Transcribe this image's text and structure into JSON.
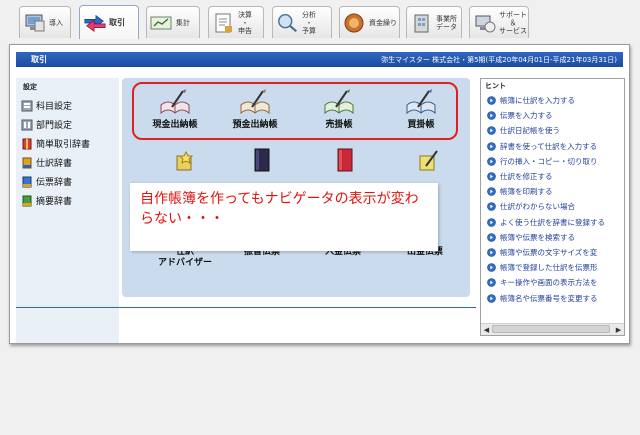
{
  "tabs": [
    {
      "id": "intro",
      "label": "導入",
      "icon": "intro-computer-icon"
    },
    {
      "id": "torihiki",
      "label": "取引",
      "icon": "transaction-arrows-icon",
      "active": true
    },
    {
      "id": "shukei",
      "label": "集計",
      "icon": "ledger-chart-icon"
    },
    {
      "id": "kessan",
      "label": "決算\n・\n申告",
      "icon": "settlement-document-icon"
    },
    {
      "id": "bunseki",
      "label": "分析\n・\n予算",
      "icon": "analysis-magnifier-icon"
    },
    {
      "id": "shikin",
      "label": "資金繰り",
      "icon": "funds-icon"
    },
    {
      "id": "jigyosho",
      "label": "事業所\nデータ",
      "icon": "office-data-icon"
    },
    {
      "id": "support",
      "label": "サポート\n＆\nサービス",
      "icon": "support-icon"
    }
  ],
  "window": {
    "title": "取引",
    "company_info": "弥生マイスター 株式会社・第5期(平成20年04月01日-平成21年03月31日)"
  },
  "side_panel": {
    "heading": "設定",
    "items": [
      {
        "label": "科目設定",
        "icon": "account-settings-icon"
      },
      {
        "label": "部門設定",
        "icon": "department-settings-icon"
      },
      {
        "label": "簡単取引辞書",
        "icon": "easy-dictionary-icon"
      },
      {
        "label": "仕訳辞書",
        "icon": "journal-dictionary-icon"
      },
      {
        "label": "伝票辞書",
        "icon": "slip-dictionary-icon"
      },
      {
        "label": "摘要辞書",
        "icon": "summary-dictionary-icon"
      }
    ]
  },
  "navigator": {
    "books": [
      {
        "label": "現金出納帳",
        "icon": "cash-book-icon"
      },
      {
        "label": "預金出納帳",
        "icon": "deposit-book-icon"
      },
      {
        "label": "売掛帳",
        "icon": "receivable-book-icon"
      },
      {
        "label": "買掛帳",
        "icon": "payable-book-icon"
      }
    ],
    "slips": [
      {
        "label": "仕訳\nアドバイザー",
        "icon": "journal-advisor-icon"
      },
      {
        "label": "振替伝票",
        "icon": "transfer-slip-icon"
      },
      {
        "label": "入金伝票",
        "icon": "receipt-slip-icon"
      },
      {
        "label": "出金伝票",
        "icon": "payment-slip-icon"
      }
    ],
    "callout_text": "自作帳簿を作ってもナビゲータの表示が変わらない・・・"
  },
  "hint_panel": {
    "heading": "ヒント",
    "items": [
      "帳簿に仕訳を入力する",
      "伝票を入力する",
      "仕訳日記帳を使う",
      "辞書を使って仕訳を入力する",
      "行の挿入・コピー・切り取り",
      "仕訳を修正する",
      "帳簿を印刷する",
      "仕訳がわからない場合",
      "よく使う仕訳を辞書に登録する",
      "帳簿や伝票を検索する",
      "帳簿や伝票の文字サイズを変",
      "帳簿で登録した仕訳を伝票形",
      "キー操作や画面の表示方法を",
      "帳簿名や伝票番号を変更する"
    ]
  },
  "colors": {
    "title_bar": "#1c4b9f",
    "navigator_bg": "#c9dbed",
    "highlight_border": "#e02020",
    "callout_text": "#e0140e",
    "hint_link": "#1f3f9f"
  }
}
